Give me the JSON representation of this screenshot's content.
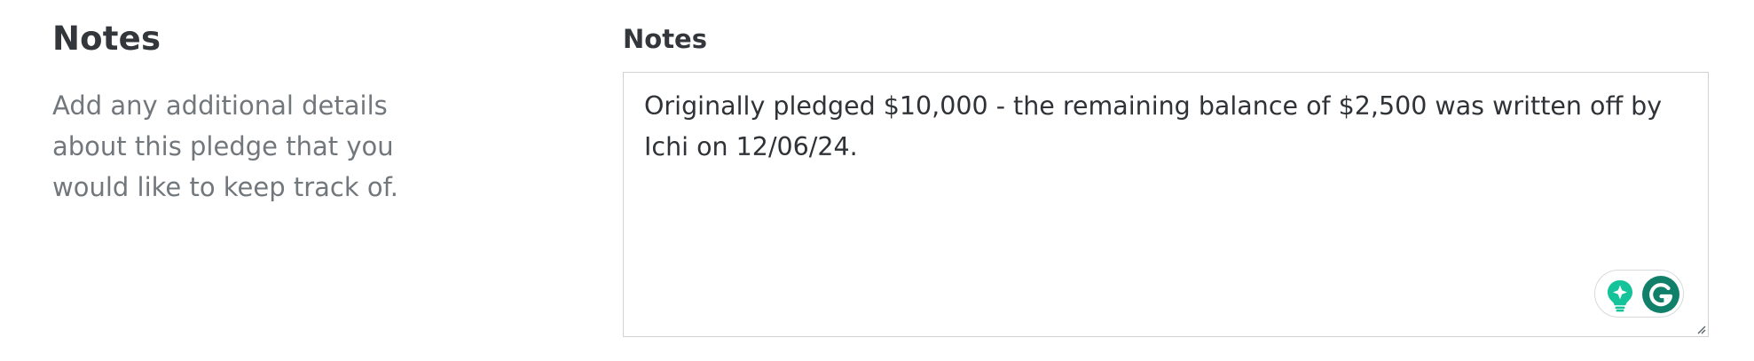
{
  "section": {
    "title": "Notes",
    "description": "Add any additional details about this pledge that you would like to keep track of."
  },
  "notes_field": {
    "label": "Notes",
    "value": "Originally pledged $10,000 - the remaining balance of $2,500 was written off by Ichi on 12/06/24."
  },
  "grammarly": {
    "suggestions_icon": "lightbulb-sparkle-icon",
    "logo_icon": "grammarly-g-icon",
    "accent_color": "#15c39a",
    "logo_color": "#11806a"
  },
  "colors": {
    "heading": "#33373b",
    "description": "#72777c",
    "border": "#cfd3d6"
  }
}
